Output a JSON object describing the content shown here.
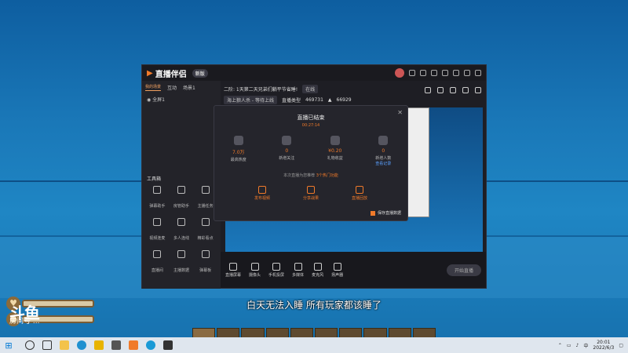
{
  "app": {
    "brand": "直播伴侣",
    "brand_badge": "新版",
    "tabs": [
      "我的场景",
      "互动",
      "场景1"
    ],
    "scene_item": "全屏1",
    "stream_title": "二阶: 1天第二天兄弟们躺平节省睡!",
    "stream_tag": "在线",
    "category": "海上狼人杀 - 等待上线",
    "category_label": "直播类型",
    "viewer_count": "469731",
    "like_count": "66929",
    "tools_title": "工具箱",
    "tools": [
      {
        "label": "弹幕助手",
        "icon": "danmaku-icon"
      },
      {
        "label": "房管助手",
        "icon": "admin-icon"
      },
      {
        "label": "主播任务",
        "icon": "task-icon"
      },
      {
        "label": "视频连麦",
        "icon": "video-icon"
      },
      {
        "label": "多人连线",
        "icon": "multi-icon"
      },
      {
        "label": "精彩看点",
        "icon": "highlight-icon"
      },
      {
        "label": "直播间",
        "icon": "room-icon"
      },
      {
        "label": "主播数据",
        "icon": "data-icon"
      },
      {
        "label": "弹幕板",
        "icon": "board-icon"
      }
    ],
    "bottom_bar": [
      {
        "label": "直播屏幕",
        "icon": "screen-icon"
      },
      {
        "label": "摄像头",
        "icon": "camera-icon"
      },
      {
        "label": "手机投屏",
        "icon": "phone-icon"
      },
      {
        "label": "多媒体",
        "icon": "media-icon"
      },
      {
        "label": "麦克风",
        "icon": "mic-icon"
      },
      {
        "label": "扬声器",
        "icon": "speaker-icon"
      }
    ],
    "start_button": "开始直播"
  },
  "modal": {
    "title": "直播已结束",
    "time": "00:27:14",
    "stats": [
      {
        "value": "7.0万",
        "label": "最高热度",
        "icon": "fire-icon"
      },
      {
        "value": "0",
        "label": "新增关注",
        "icon": "heart-icon"
      },
      {
        "value": "¥0.20",
        "label": "礼物收益",
        "icon": "gift-icon"
      },
      {
        "value": "0",
        "label": "新增人数",
        "icon": "user-icon",
        "link": "查看记录"
      }
    ],
    "tip": "本次直播为您推荐",
    "tip_highlight": "3个热门功能",
    "actions": [
      {
        "label": "发布视频",
        "icon": "video-icon"
      },
      {
        "label": "分享战果",
        "icon": "share-icon"
      },
      {
        "label": "直播回放",
        "icon": "replay-icon"
      }
    ],
    "footer": "保存直播数据"
  },
  "game": {
    "subtitle": "白天无法入睡  所有玩家都该睡了",
    "watermark_logo": "斗鱼",
    "watermark_text": "房间号 ..."
  },
  "taskbar": {
    "time": "20:01",
    "date": "2022/6/3",
    "lang": "中"
  }
}
